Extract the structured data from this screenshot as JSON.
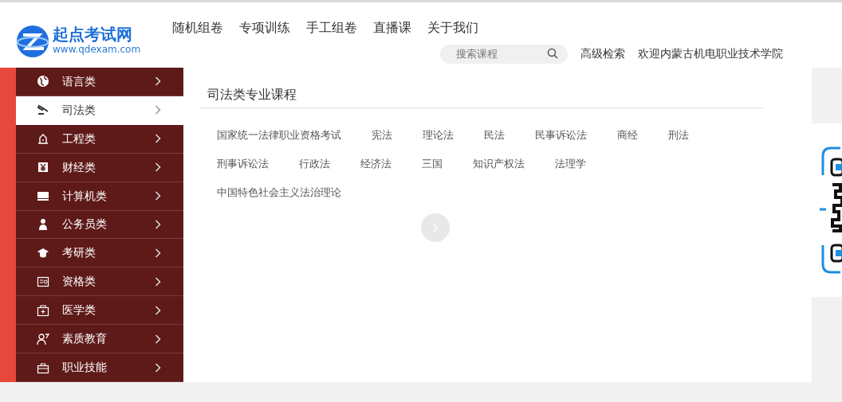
{
  "header": {
    "logo": {
      "name": "起点考试网",
      "url": "www.qdexam.com"
    },
    "nav": [
      {
        "label": "随机组卷"
      },
      {
        "label": "专项训练"
      },
      {
        "label": "手工组卷"
      },
      {
        "label": "直播课"
      },
      {
        "label": "关于我们"
      }
    ],
    "search": {
      "placeholder": "搜索课程"
    },
    "advanced_search": "高级检索",
    "welcome": "欢迎内蒙古机电职业技术学院"
  },
  "sidebar": {
    "items": [
      {
        "label": "语言类",
        "selected": false
      },
      {
        "label": "司法类",
        "selected": true
      },
      {
        "label": "工程类",
        "selected": false
      },
      {
        "label": "财经类",
        "selected": false
      },
      {
        "label": "计算机类",
        "selected": false
      },
      {
        "label": "公务员类",
        "selected": false
      },
      {
        "label": "考研类",
        "selected": false
      },
      {
        "label": "资格类",
        "selected": false
      },
      {
        "label": "医学类",
        "selected": false
      },
      {
        "label": "素质教育",
        "selected": false
      },
      {
        "label": "职业技能",
        "selected": false
      }
    ]
  },
  "panel": {
    "title": "司法类专业课程",
    "courses": [
      "国家统一法律职业资格考试",
      "宪法",
      "理论法",
      "民法",
      "民事诉讼法",
      "商经",
      "刑法",
      "刑事诉讼法",
      "行政法",
      "经济法",
      "三国",
      "知识产权法",
      "法理学",
      "中国特色社会主义法治理论"
    ]
  }
}
